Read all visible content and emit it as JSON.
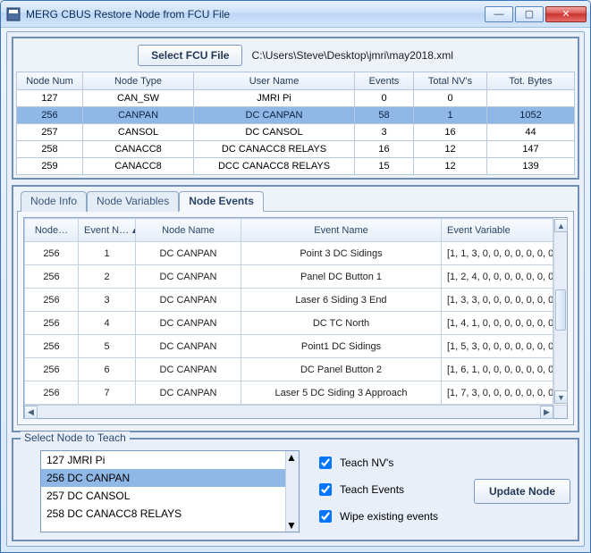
{
  "window": {
    "title": "MERG CBUS Restore Node from FCU File"
  },
  "toolbar": {
    "select_file": "Select FCU File",
    "file_path": "C:\\Users\\Steve\\Desktop\\jmri\\may2018.xml"
  },
  "nodes_table": {
    "headers": [
      "Node Num",
      "Node Type",
      "User Name",
      "Events",
      "Total NV's",
      "Tot. Bytes"
    ],
    "selected_index": 1,
    "rows": [
      [
        "127",
        "CAN_SW",
        "JMRI Pi",
        "0",
        "0",
        ""
      ],
      [
        "256",
        "CANPAN",
        "DC CANPAN",
        "58",
        "1",
        "1052"
      ],
      [
        "257",
        "CANSOL",
        "DC CANSOL",
        "3",
        "16",
        "44"
      ],
      [
        "258",
        "CANACC8",
        "DC CANACC8 RELAYS",
        "16",
        "12",
        "147"
      ],
      [
        "259",
        "CANACC8",
        "DCC CANACC8 RELAYS",
        "15",
        "12",
        "139"
      ]
    ]
  },
  "tabs": {
    "labels": [
      "Node Info",
      "Node Variables",
      "Node Events"
    ],
    "active_index": 2
  },
  "events_table": {
    "headers": [
      "Node…",
      "Event N…",
      "Node Name",
      "Event Name",
      "Event Variable"
    ],
    "sort_col": 1,
    "rows": [
      [
        "256",
        "1",
        "DC CANPAN",
        "Point 3 DC Sidings",
        "[1, 1, 3, 0, 0, 0, 0, 0, 0, 0, "
      ],
      [
        "256",
        "2",
        "DC CANPAN",
        "Panel DC Button 1",
        "[1, 2, 4, 0, 0, 0, 0, 0, 0, 0, "
      ],
      [
        "256",
        "3",
        "DC CANPAN",
        "Laser 6 Siding 3 End",
        "[1, 3, 3, 0, 0, 0, 0, 0, 0, 0, "
      ],
      [
        "256",
        "4",
        "DC CANPAN",
        "DC TC North",
        "[1, 4, 1, 0, 0, 0, 0, 0, 0, 0, "
      ],
      [
        "256",
        "5",
        "DC CANPAN",
        "Point1 DC Sidings",
        "[1, 5, 3, 0, 0, 0, 0, 0, 0, 0, "
      ],
      [
        "256",
        "6",
        "DC CANPAN",
        "DC Panel Button 2",
        "[1, 6, 1, 0, 0, 0, 0, 0, 0, 0, "
      ],
      [
        "256",
        "7",
        "DC CANPAN",
        "Laser 5 DC Siding 3 Approach",
        "[1, 7, 3, 0, 0, 0, 0, 0, 0, 0, "
      ]
    ]
  },
  "teach": {
    "legend": "Select Node to Teach",
    "list_selected_index": 1,
    "list": [
      "127 JMRI Pi",
      "256 DC CANPAN",
      "257 DC CANSOL",
      "258 DC CANACC8 RELAYS"
    ],
    "check_nv": "Teach NV's",
    "check_events": "Teach Events",
    "check_wipe": "Wipe existing events",
    "update_label": "Update Node",
    "nv_checked": true,
    "events_checked": true,
    "wipe_checked": true
  }
}
